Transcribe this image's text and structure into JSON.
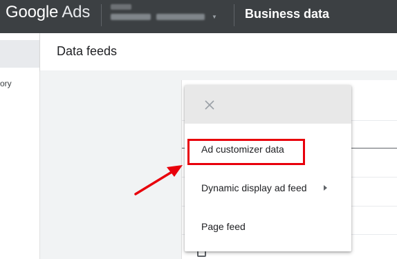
{
  "header": {
    "logo_google": "Google",
    "logo_ads": "Ads",
    "page_section": "Business data"
  },
  "leftnav": {
    "partial_item": "ory"
  },
  "page": {
    "title": "Data feeds"
  },
  "menu": {
    "items": [
      {
        "label": "Ad customizer data",
        "has_submenu": false,
        "highlighted": true
      },
      {
        "label": "Dynamic display ad feed",
        "has_submenu": true,
        "highlighted": false
      },
      {
        "label": "Page feed",
        "has_submenu": false,
        "highlighted": false
      }
    ]
  },
  "colors": {
    "topbar": "#3c4043",
    "annotation_red": "#e8000b",
    "menu_header": "#e8e8e8"
  }
}
